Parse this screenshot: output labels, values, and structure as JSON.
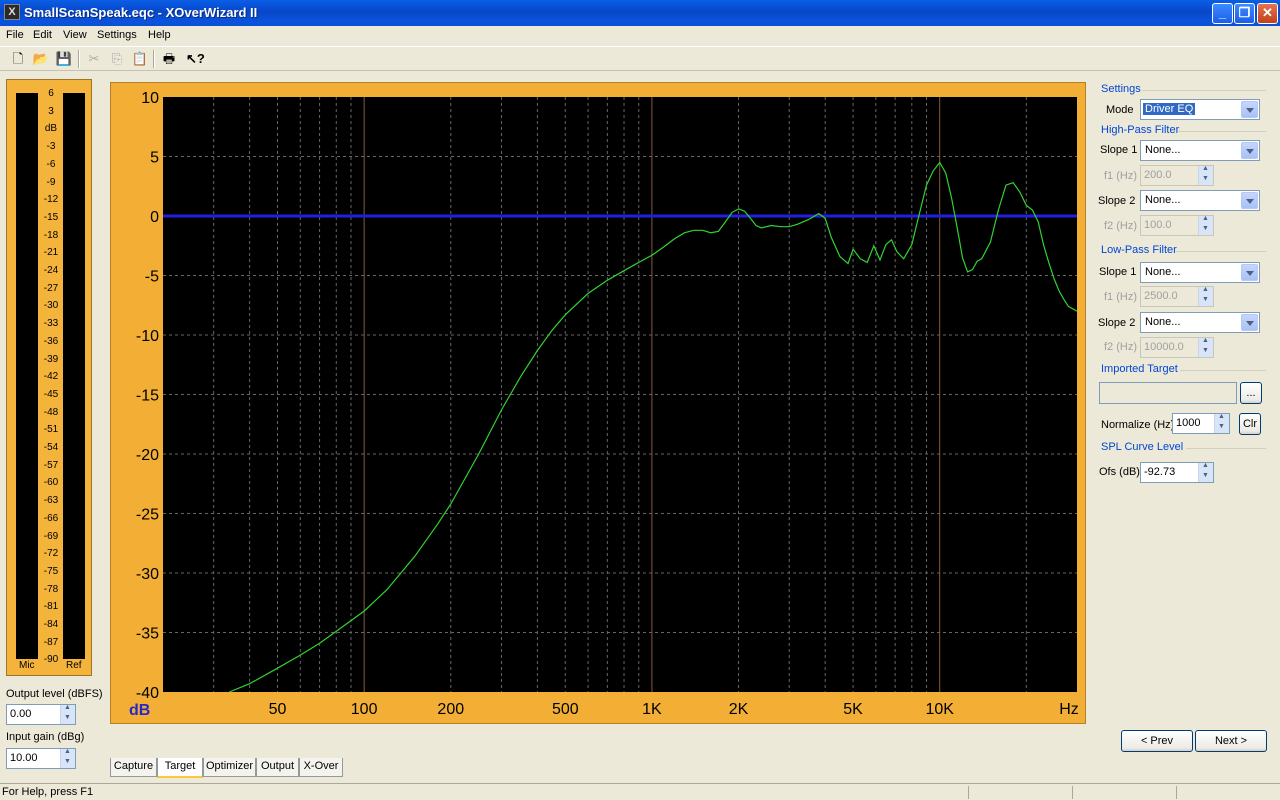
{
  "window": {
    "title": "SmallScanSpeak.eqc - XOverWizard II",
    "app_icon": "X"
  },
  "menu": [
    "File",
    "Edit",
    "View",
    "Settings",
    "Help"
  ],
  "toolbar": {
    "icons": [
      "new-file-icon",
      "open-folder-icon",
      "save-icon",
      "cut-icon",
      "copy-icon",
      "paste-icon",
      "print-icon",
      "context-help-icon"
    ]
  },
  "meters": {
    "scale": [
      "6",
      "3",
      "dB",
      "-3",
      "-6",
      "-9",
      "-12",
      "-15",
      "-18",
      "-21",
      "-24",
      "-27",
      "-30",
      "-33",
      "-36",
      "-39",
      "-42",
      "-45",
      "-48",
      "-51",
      "-54",
      "-57",
      "-60",
      "-63",
      "-66",
      "-69",
      "-72",
      "-75",
      "-78",
      "-81",
      "-84",
      "-87",
      "-90"
    ],
    "mic_label": "Mic",
    "ref_label": "Ref"
  },
  "output_level": {
    "label": "Output level (dBFS)",
    "value": "0.00"
  },
  "input_gain": {
    "label": "Input gain (dBg)",
    "value": "10.00"
  },
  "chart_data": {
    "type": "line",
    "x_scale": "log",
    "xlim": [
      20,
      30000
    ],
    "ylim": [
      -40,
      10
    ],
    "y_ticks": [
      10,
      5,
      0,
      -5,
      -10,
      -15,
      -20,
      -25,
      -30,
      -35,
      -40
    ],
    "y_tick_labels": [
      "10",
      "5",
      "0",
      "-5",
      "-10",
      "-15",
      "-20",
      "-25",
      "-30",
      "-35",
      "-40"
    ],
    "x_ticks": [
      50,
      100,
      200,
      500,
      1000,
      2000,
      5000,
      10000
    ],
    "x_tick_labels": [
      "50",
      "100",
      "200",
      "500",
      "1K",
      "2K",
      "5K",
      "10K"
    ],
    "ylabel": "dB",
    "xlabel": "Hz",
    "colors": {
      "background": "#000000",
      "frame": "#f3af35",
      "target": "#2020e0",
      "response": "#32d232",
      "grid": "#666666",
      "axis_text": "#2828c8"
    },
    "series": [
      {
        "kind": "target",
        "x": [
          20,
          30000
        ],
        "y": [
          0,
          0
        ]
      },
      {
        "kind": "response",
        "x": [
          34,
          40,
          50,
          60,
          70,
          80,
          90,
          100,
          120,
          150,
          180,
          200,
          250,
          300,
          350,
          400,
          450,
          500,
          600,
          700,
          800,
          900,
          1000,
          1100,
          1200,
          1300,
          1400,
          1500,
          1600,
          1700,
          1800,
          1900,
          2000,
          2100,
          2200,
          2300,
          2400,
          2600,
          2800,
          3000,
          3200,
          3500,
          3800,
          4000,
          4200,
          4500,
          4800,
          5000,
          5300,
          5600,
          5900,
          6200,
          6500,
          6800,
          7100,
          7500,
          8000,
          8500,
          9000,
          9500,
          10000,
          10500,
          11000,
          11500,
          12000,
          12500,
          13000,
          13500,
          14000,
          15000,
          16000,
          17000,
          18000,
          19000,
          20000,
          21000,
          22000,
          23000,
          24000,
          25000,
          26000,
          27000,
          28000,
          29000,
          30000
        ],
        "y": [
          -40,
          -39.3,
          -38,
          -36.9,
          -35.9,
          -34.9,
          -34,
          -33.2,
          -31.4,
          -28.6,
          -25.9,
          -24.2,
          -20,
          -16.3,
          -13.5,
          -11.3,
          -9.6,
          -8.3,
          -6.5,
          -5.4,
          -4.6,
          -3.9,
          -3.3,
          -2.6,
          -1.9,
          -1.4,
          -1.2,
          -1.2,
          -1.4,
          -1.3,
          -0.5,
          0.3,
          0.6,
          0.4,
          -0.2,
          -0.8,
          -1,
          -0.8,
          -0.9,
          -0.9,
          -0.7,
          -0.3,
          0.2,
          -0.2,
          -1.8,
          -3.4,
          -4,
          -2.8,
          -3.6,
          -3.9,
          -2.5,
          -3.7,
          -2.4,
          -2,
          -3,
          -3.6,
          -2.4,
          0.2,
          2.6,
          3.8,
          4.5,
          3.6,
          1.5,
          -1,
          -3.5,
          -4.7,
          -4.5,
          -3.8,
          -3.6,
          -2.2,
          0.5,
          2.6,
          2.8,
          2,
          0.9,
          0.5,
          -0.5,
          -2.5,
          -4,
          -5.3,
          -6.3,
          -7,
          -7.6,
          -7.8,
          -8
        ]
      }
    ]
  },
  "settings": {
    "group_title": "Settings",
    "mode_label": "Mode",
    "mode_value": "Driver EQ",
    "hpf": {
      "title": "High-Pass Filter",
      "slope1_label": "Slope 1",
      "slope1_value": "None...",
      "f1_label": "f1 (Hz)",
      "f1_value": "200.0",
      "slope2_label": "Slope 2",
      "slope2_value": "None...",
      "f2_label": "f2 (Hz)",
      "f2_value": "100.0"
    },
    "lpf": {
      "title": "Low-Pass Filter",
      "slope1_label": "Slope 1",
      "slope1_value": "None...",
      "f1_label": "f1 (Hz)",
      "f1_value": "2500.0",
      "slope2_label": "Slope 2",
      "slope2_value": "None...",
      "f2_label": "f2 (Hz)",
      "f2_value": "10000.0"
    },
    "imported": {
      "title": "Imported Target",
      "path_value": "",
      "browse_label": "...",
      "normalize_label": "Normalize (Hz)",
      "normalize_value": "1000",
      "clear_label": "Clr"
    },
    "spl": {
      "title": "SPL Curve Level",
      "ofs_label": "Ofs (dB)",
      "ofs_value": "-92.73"
    }
  },
  "nav": {
    "prev_label": "< Prev",
    "next_label": "Next >"
  },
  "tabs": [
    {
      "label": "Capture",
      "active": false
    },
    {
      "label": "Target",
      "active": true
    },
    {
      "label": "Optimizer",
      "active": false
    },
    {
      "label": "Output",
      "active": false
    },
    {
      "label": "X-Over",
      "active": false
    }
  ],
  "status": {
    "text": "For Help, press F1"
  }
}
